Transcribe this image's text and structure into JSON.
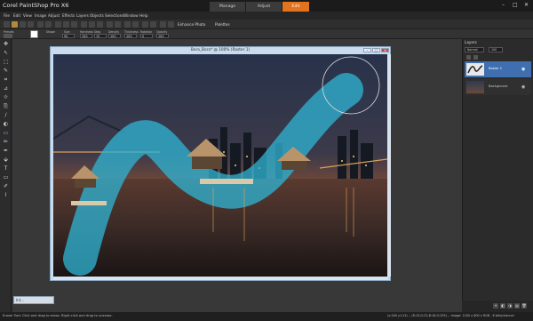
{
  "app": {
    "title": "Corel PaintShop Pro X6"
  },
  "workspace_tabs": [
    {
      "label": "Manage",
      "active": false
    },
    {
      "label": "Adjust",
      "active": false
    },
    {
      "label": "Edit",
      "active": true
    }
  ],
  "window_controls": {
    "minimize": "–",
    "maximize": "□",
    "close": "✕"
  },
  "menu": [
    "File",
    "Edit",
    "View",
    "Image",
    "Adjust",
    "Effects",
    "Layers",
    "Objects",
    "Selections",
    "Window",
    "Help"
  ],
  "toolbar": {
    "enhance_photo": "Enhance Photo",
    "palettes": "Palettes"
  },
  "options": {
    "presets_label": "Presets",
    "shape_label": "Shape",
    "size_label": "Size",
    "size": "90",
    "hardness_label": "Hardness",
    "hardness": "100",
    "step_label": "Step",
    "step": "15",
    "density_label": "Density",
    "density": "100",
    "thickness_label": "Thickness",
    "thickness": "100",
    "rotation_label": "Rotation",
    "rotation": "0",
    "opacity_label": "Opacity",
    "opacity": "100"
  },
  "document": {
    "title": "Bora_Bora* @ 100% (Raster 1)",
    "min": "–",
    "max": "□",
    "close": "✕"
  },
  "layers_panel": {
    "title": "Layers",
    "blend_mode": "Normal",
    "opacity": "100",
    "layers": [
      {
        "name": "Raster 1",
        "selected": true
      },
      {
        "name": "Background",
        "selected": false
      }
    ]
  },
  "mini_tools": "Int...",
  "status": {
    "left": "Eraser Tool: Click and drag to erase. Right-click and drag to unerase.",
    "right": "(x:164 y:113) -- (R:15,G:22,B:18,O:255) -- Image: 1200 x 800 x RGB - 8 bits/channel"
  },
  "colors": {
    "accent": "#e4731e",
    "selection": "#3f6fb0",
    "chrome": "#2b2b2b"
  }
}
